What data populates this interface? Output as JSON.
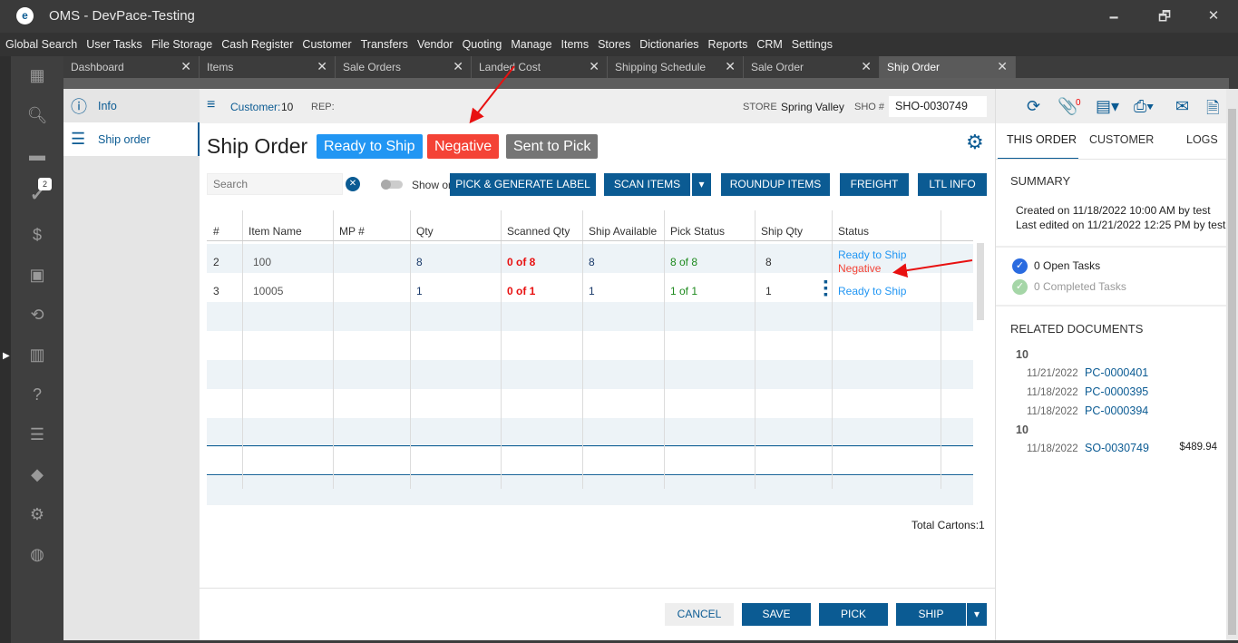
{
  "window": {
    "title": "OMS - DevPace-Testing",
    "minimize": "🗕",
    "maximize": "🗗",
    "close": "✕"
  },
  "menu": [
    "Global Search",
    "User Tasks",
    "File Storage",
    "Cash Register",
    "Customer",
    "Transfers",
    "Vendor",
    "Quoting",
    "Manage",
    "Items",
    "Stores",
    "Dictionaries",
    "Reports",
    "CRM",
    "Settings"
  ],
  "rail": {
    "tasks_badge": "2",
    "icons": [
      "dashboard-icon",
      "search-icon",
      "folder-icon",
      "tasks-icon",
      "dollar-icon",
      "contact-icon",
      "transfer-icon",
      "store-icon",
      "help-clipboard-icon",
      "clipboard-icon",
      "tag-icon",
      "gear-icon",
      "globe-icon"
    ]
  },
  "tabs": [
    {
      "label": "Dashboard"
    },
    {
      "label": "Items"
    },
    {
      "label": "Sale Orders"
    },
    {
      "label": "Landed Cost"
    },
    {
      "label": "Shipping Schedule"
    },
    {
      "label": "Sale Order"
    },
    {
      "label": "Ship Order",
      "active": true
    }
  ],
  "leftnav": [
    {
      "label": "Info",
      "icon": "info-icon"
    },
    {
      "label": "Ship order",
      "icon": "list-icon",
      "active": true
    }
  ],
  "header": {
    "customer_label": "Customer:",
    "customer_value": "10",
    "rep_label": "REP:",
    "store_label": "STORE",
    "store_value": "Spring Valley",
    "sho_label": "SHO #",
    "sho_value": "SHO-0030749"
  },
  "page": {
    "title": "Ship Order",
    "chips": [
      {
        "label": "Ready to Ship",
        "color": "#2196f3"
      },
      {
        "label": "Negative",
        "color": "#f44336"
      },
      {
        "label": "Sent to Pick",
        "color": "#757575"
      }
    ]
  },
  "toolbar": {
    "search_placeholder": "Search",
    "show_only_label": "Show or",
    "pick_generate": "PICK & GENERATE LABEL",
    "scan_items": "SCAN ITEMS",
    "roundup": "ROUNDUP ITEMS",
    "freight": "FREIGHT",
    "ltl": "LTL INFO"
  },
  "table": {
    "columns": [
      "#",
      "Item Name",
      "MP #",
      "Qty",
      "Scanned Qty",
      "Ship Available",
      "Pick Status",
      "Ship Qty",
      "Status"
    ],
    "rows": [
      {
        "num": "2",
        "item": "100",
        "mp": "",
        "qty": "8",
        "scanned": "0 of 8",
        "avail": "8",
        "pick": "8 of 8",
        "shipqty": "8",
        "status": [
          "Ready to Ship",
          "Negative"
        ]
      },
      {
        "num": "3",
        "item": "10005",
        "mp": "",
        "qty": "1",
        "scanned": "0 of 1",
        "avail": "1",
        "pick": "1 of 1",
        "shipqty": "1",
        "status": [
          "Ready to Ship"
        ]
      }
    ]
  },
  "footer": {
    "total_cartons": "Total Cartons:1",
    "cancel": "CANCEL",
    "save": "SAVE",
    "pick": "PICK",
    "ship": "SHIP"
  },
  "right": {
    "attach_count": "0",
    "tabs": [
      "THIS ORDER",
      "CUSTOMER",
      "LOGS"
    ],
    "summary_title": "SUMMARY",
    "created": "Created on 11/18/2022 10:00 AM by test",
    "edited": "Last edited on 11/21/2022 12:25 PM by test",
    "open_tasks": "0 Open Tasks",
    "completed_tasks": "0 Completed Tasks",
    "related_title": "RELATED DOCUMENTS",
    "groups": [
      {
        "name": "10",
        "docs": [
          {
            "date": "11/21/2022",
            "id": "PC-0000401",
            "amount": ""
          },
          {
            "date": "11/18/2022",
            "id": "PC-0000395",
            "amount": ""
          },
          {
            "date": "11/18/2022",
            "id": "PC-0000394",
            "amount": ""
          }
        ]
      },
      {
        "name": "10",
        "docs": [
          {
            "date": "11/18/2022",
            "id": "SO-0030749",
            "amount": "$489.94"
          }
        ]
      }
    ]
  },
  "colors": {
    "accent": "#0b5b93",
    "negative": "#f44336",
    "ready": "#2196f3",
    "pick_ok": "#1e8a1e",
    "annotation_arrow": "#e81010"
  }
}
